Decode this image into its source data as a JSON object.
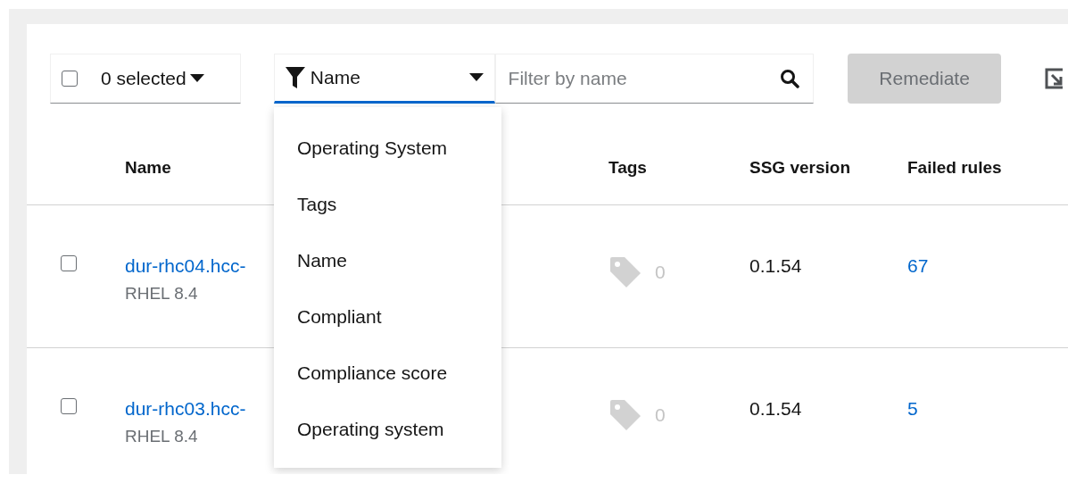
{
  "toolbar": {
    "bulk_select": {
      "checked": false,
      "label": "0 selected"
    },
    "filter": {
      "label": "Name",
      "expanded": true,
      "options": [
        "Operating System",
        "Tags",
        "Name",
        "Compliant",
        "Compliance score",
        "Operating system"
      ]
    },
    "search": {
      "placeholder": "Filter by name"
    },
    "remediate": {
      "label": "Remediate",
      "disabled": true
    }
  },
  "table": {
    "columns": [
      "Name",
      "Tags",
      "SSG version",
      "Failed rules"
    ],
    "rows": [
      {
        "checked": false,
        "name": "dur-rhc04.hcc-",
        "os": "RHEL 8.4",
        "tags": "0",
        "ssg": "0.1.54",
        "failed": "67"
      },
      {
        "checked": false,
        "name": "dur-rhc03.hcc-",
        "os": "RHEL 8.4",
        "tags": "0",
        "ssg": "0.1.54",
        "failed": "5"
      }
    ]
  }
}
